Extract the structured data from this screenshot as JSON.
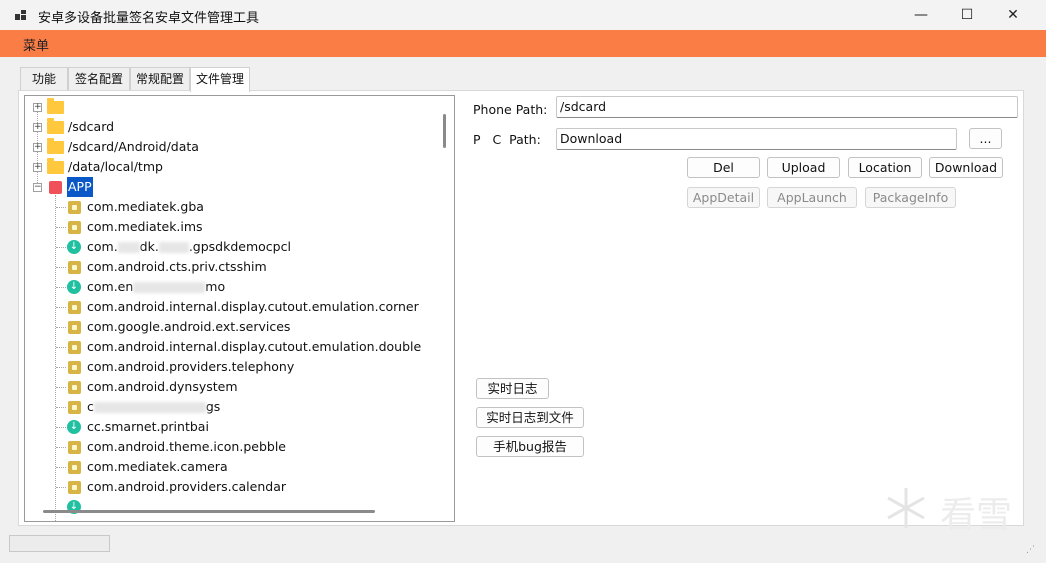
{
  "window": {
    "title": "安卓多设备批量签名安卓文件管理工具",
    "minimize_glyph": "—",
    "maximize_glyph": "☐",
    "close_glyph": "✕",
    "accent_color": "#fb7d46"
  },
  "menu": {
    "label": "菜单"
  },
  "tabs": [
    {
      "label": "功能",
      "active": false
    },
    {
      "label": "签名配置",
      "active": false
    },
    {
      "label": "常规配置",
      "active": false
    },
    {
      "label": "文件管理",
      "active": true
    }
  ],
  "tree": {
    "roots": [
      {
        "label": "",
        "icon": "folder-icon",
        "expander": "+"
      },
      {
        "label": "/sdcard",
        "icon": "folder-icon",
        "expander": "+"
      },
      {
        "label": "/sdcard/Android/data",
        "icon": "folder-icon",
        "expander": "+"
      },
      {
        "label": "/data/local/tmp",
        "icon": "folder-icon",
        "expander": "+"
      },
      {
        "label": "APP",
        "icon": "app-folder-icon",
        "expander": "−",
        "selected": true
      }
    ],
    "apps": [
      {
        "pre": "com.mediatek.gba",
        "post": "",
        "icon": "package-icon"
      },
      {
        "pre": "com.mediatek.ims",
        "post": "",
        "icon": "package-icon"
      },
      {
        "pre": "com.",
        "post": "dk.",
        "post2": ".gpsdkdemocpcl",
        "icon": "apk-icon"
      },
      {
        "pre": "com.android.cts.priv.ctsshim",
        "post": "",
        "icon": "package-icon"
      },
      {
        "pre": "com.en",
        "post": "mo",
        "icon": "apk-icon"
      },
      {
        "pre": "com.android.internal.display.cutout.emulation.corner",
        "post": "",
        "icon": "package-icon"
      },
      {
        "pre": "com.google.android.ext.services",
        "post": "",
        "icon": "package-icon"
      },
      {
        "pre": "com.android.internal.display.cutout.emulation.double",
        "post": "",
        "icon": "package-icon"
      },
      {
        "pre": "com.android.providers.telephony",
        "post": "",
        "icon": "package-icon"
      },
      {
        "pre": "com.android.dynsystem",
        "post": "",
        "icon": "package-icon"
      },
      {
        "pre": "c",
        "post": "gs",
        "icon": "package-icon"
      },
      {
        "pre": "cc.smarnet.printbai",
        "post": "",
        "icon": "apk-icon"
      },
      {
        "pre": "com.android.theme.icon.pebble",
        "post": "",
        "icon": "package-icon"
      },
      {
        "pre": "com.mediatek.camera",
        "post": "",
        "icon": "package-icon"
      },
      {
        "pre": "com.android.providers.calendar",
        "post": "",
        "icon": "package-icon"
      }
    ]
  },
  "paths": {
    "phone_label": "Phone Path:",
    "phone_value": "/sdcard",
    "pc_label": "P   C  Path:",
    "pc_value": "Download",
    "browse_label": "..."
  },
  "actions": {
    "del": "Del",
    "upload": "Upload",
    "location": "Location",
    "download": "Download",
    "app_detail": "AppDetail",
    "app_launch": "AppLaunch",
    "package_info": "PackageInfo"
  },
  "log_buttons": {
    "realtime_log": "实时日志",
    "realtime_log_to_file": "实时日志到文件",
    "bug_report": "手机bug报告"
  },
  "watermark": {
    "text": "看雪"
  }
}
